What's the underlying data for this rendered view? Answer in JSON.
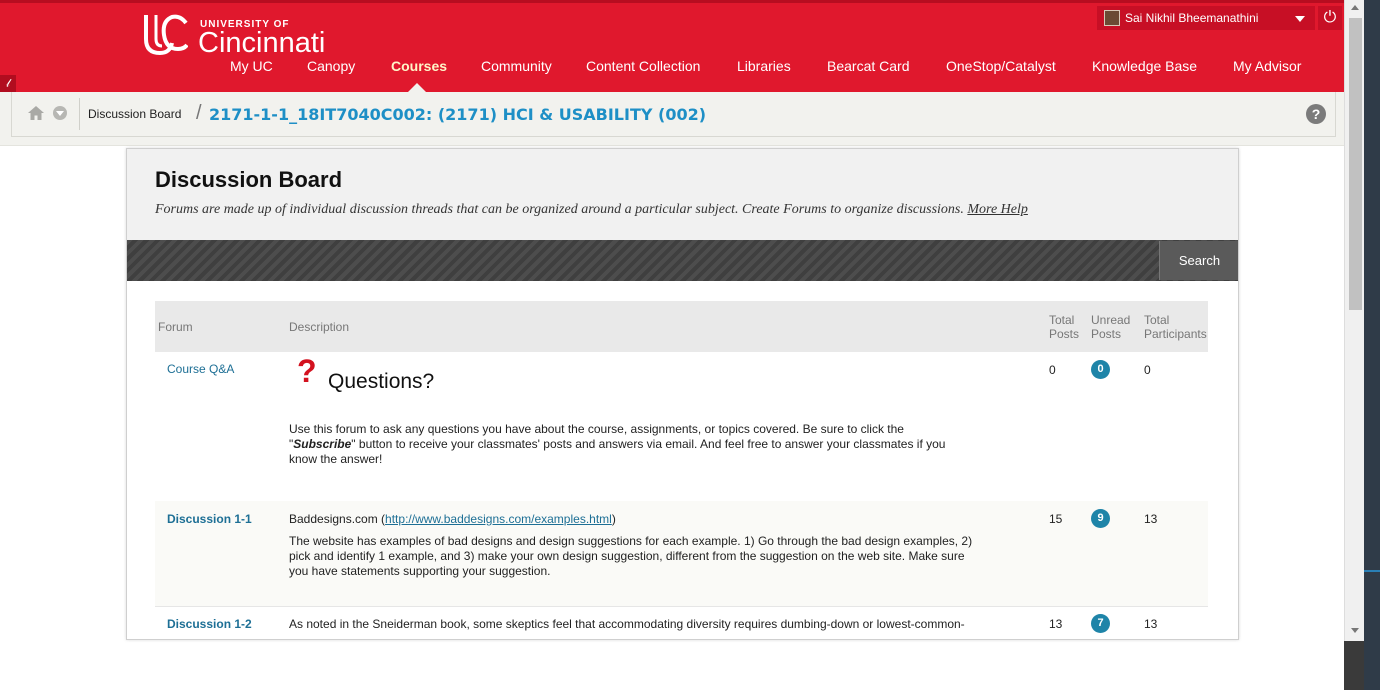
{
  "header": {
    "logo_top": "UNIVERSITY OF",
    "logo_main": "Cincinnati",
    "nav": [
      {
        "label": "My UC"
      },
      {
        "label": "Canopy"
      },
      {
        "label": "Courses"
      },
      {
        "label": "Community"
      },
      {
        "label": "Content Collection"
      },
      {
        "label": "Libraries"
      },
      {
        "label": "Bearcat Card"
      },
      {
        "label": "OneStop/Catalyst"
      },
      {
        "label": "Knowledge Base"
      },
      {
        "label": "My Advisor"
      }
    ],
    "active_nav": "Courses",
    "user_name": "Sai Nikhil Bheemanathini",
    "brand_color": "#e0182d"
  },
  "breadcrumb": {
    "item1": "Discussion Board",
    "separator": "/",
    "item2": "2171-1-1_18IT7040C002: (2171) HCI & USABILITY (002)",
    "help": "?"
  },
  "page": {
    "title": "Discussion Board",
    "description": "Forums are made up of individual discussion threads that can be organized around a particular subject. Create Forums to organize discussions.",
    "more_help": "More Help",
    "search_label": "Search"
  },
  "table": {
    "headers": {
      "forum": "Forum",
      "description": "Description",
      "total_posts_1": "Total",
      "total_posts_2": "Posts",
      "unread_posts_1": "Unread",
      "unread_posts_2": "Posts",
      "total_participants_1": "Total",
      "total_participants_2": "Participants"
    },
    "rows": [
      {
        "forum": "Course Q&A",
        "heading": "Questions?",
        "text_1": "Use this forum to ask any questions you have about the course, assignments, or topics covered. Be sure to click the",
        "text_2_pre": "\"",
        "text_2_bold": "Subscribe",
        "text_2_post": "\" button to receive your classmates' posts and answers via email. And feel free to answer your classmates if you",
        "text_3": "know the answer!",
        "total_posts": "0",
        "unread_posts": "0",
        "total_participants": "0"
      },
      {
        "forum": "Discussion 1-1",
        "line1_pre": "Baddesigns.com (",
        "line1_link": "http://www.baddesigns.com/examples.html",
        "line1_post": ")",
        "text_1": "The website has examples of bad designs and design suggestions for each example. 1) Go through the bad design examples, 2)",
        "text_2": "pick and identify 1 example, and 3) make your own design suggestion, different from the suggestion on the web site. Make sure",
        "text_3": "you have statements supporting your suggestion.",
        "total_posts": "15",
        "unread_posts": "9",
        "total_participants": "13"
      },
      {
        "forum": "Discussion 1-2",
        "text_1": "As noted in the Sneiderman book, some skeptics feel that accommodating diversity requires dumbing-down or lowest-common-",
        "total_posts": "13",
        "unread_posts": "7",
        "total_participants": "13"
      }
    ]
  }
}
